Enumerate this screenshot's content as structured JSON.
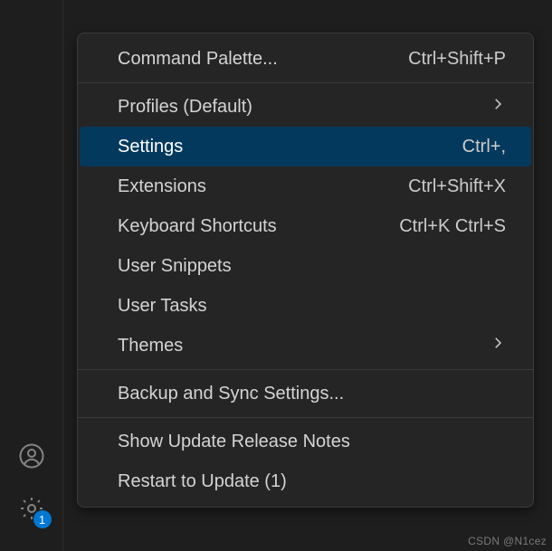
{
  "activity": {
    "accounts_label": "Accounts",
    "manage_label": "Manage",
    "badge_count": "1"
  },
  "menu": {
    "command_palette": {
      "label": "Command Palette...",
      "shortcut": "Ctrl+Shift+P"
    },
    "profiles": {
      "label": "Profiles (Default)"
    },
    "settings": {
      "label": "Settings",
      "shortcut": "Ctrl+,"
    },
    "extensions": {
      "label": "Extensions",
      "shortcut": "Ctrl+Shift+X"
    },
    "keyboard": {
      "label": "Keyboard Shortcuts",
      "shortcut": "Ctrl+K Ctrl+S"
    },
    "snippets": {
      "label": "User Snippets"
    },
    "tasks": {
      "label": "User Tasks"
    },
    "themes": {
      "label": "Themes"
    },
    "backup": {
      "label": "Backup and Sync Settings..."
    },
    "release_notes": {
      "label": "Show Update Release Notes"
    },
    "restart": {
      "label": "Restart to Update (1)"
    }
  },
  "watermark": "CSDN @N1cez"
}
